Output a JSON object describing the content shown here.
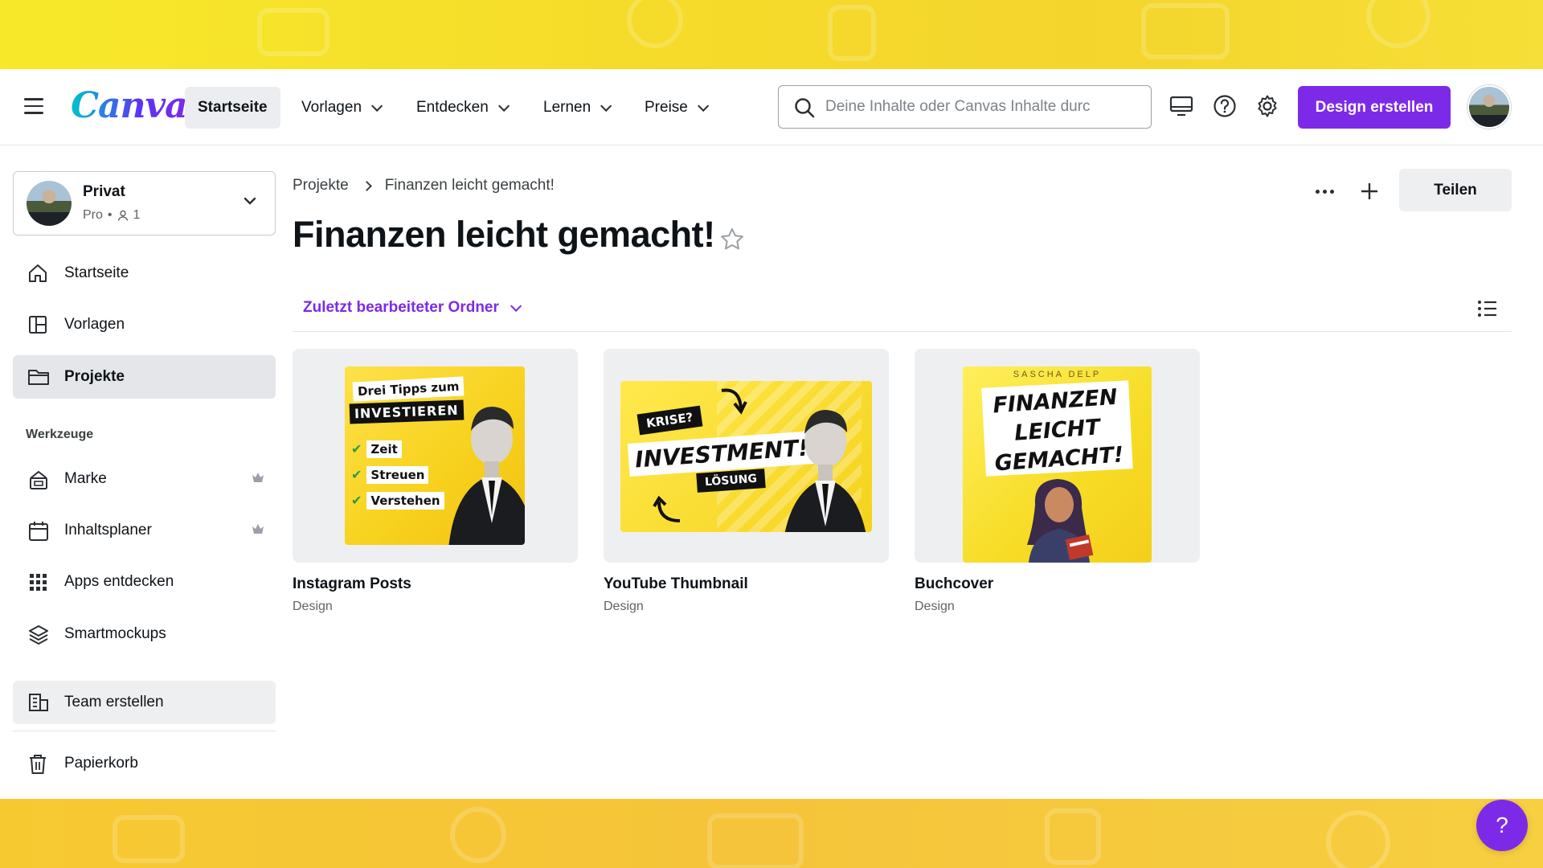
{
  "header": {
    "logo": "Canva",
    "nav": [
      {
        "label": "Startseite",
        "active": true
      },
      {
        "label": "Vorlagen"
      },
      {
        "label": "Entdecken"
      },
      {
        "label": "Lernen"
      },
      {
        "label": "Preise"
      }
    ],
    "search_placeholder": "Deine Inhalte oder Canvas Inhalte durc",
    "create_button": "Design erstellen",
    "icons": [
      "desktop-icon",
      "help-icon",
      "gear-icon"
    ]
  },
  "sidebar": {
    "team": {
      "name": "Privat",
      "plan": "Pro",
      "members": "1"
    },
    "items": [
      {
        "label": "Startseite",
        "icon": "home-icon"
      },
      {
        "label": "Vorlagen",
        "icon": "template-icon"
      },
      {
        "label": "Projekte",
        "icon": "folder-icon",
        "active": true
      }
    ],
    "tools_heading": "Werkzeuge",
    "tools": [
      {
        "label": "Marke",
        "icon": "brand-icon",
        "pro": true
      },
      {
        "label": "Inhaltsplaner",
        "icon": "calendar-icon",
        "pro": true
      },
      {
        "label": "Apps entdecken",
        "icon": "apps-grid-icon"
      },
      {
        "label": "Smartmockups",
        "icon": "layers-icon"
      }
    ],
    "team_create": "Team erstellen",
    "trash": "Papierkorb"
  },
  "main": {
    "breadcrumb": [
      "Projekte",
      "Finanzen leicht gemacht!"
    ],
    "title": "Finanzen leicht gemacht!",
    "share_button": "Teilen",
    "sort_label": "Zuletzt bearbeiteter Ordner",
    "designs": [
      {
        "title": "Instagram Posts",
        "type": "Design",
        "art": {
          "line1": "Drei Tipps zum",
          "line2": "INVESTIEREN",
          "bullets": [
            "Zeit",
            "Streuen",
            "Verstehen"
          ]
        }
      },
      {
        "title": "YouTube Thumbnail",
        "type": "Design",
        "art": {
          "tag": "KRISE?",
          "headline": "INVESTMENT!",
          "sub": "LÖSUNG"
        }
      },
      {
        "title": "Buchcover",
        "type": "Design",
        "art": {
          "author": "SASCHA DELP",
          "headline": [
            "FINANZEN",
            "LEICHT",
            "GEMACHT!"
          ]
        }
      }
    ]
  },
  "help_fab": "?",
  "colors": {
    "accent": "#7d2ae8",
    "background": "#f3d21a"
  }
}
